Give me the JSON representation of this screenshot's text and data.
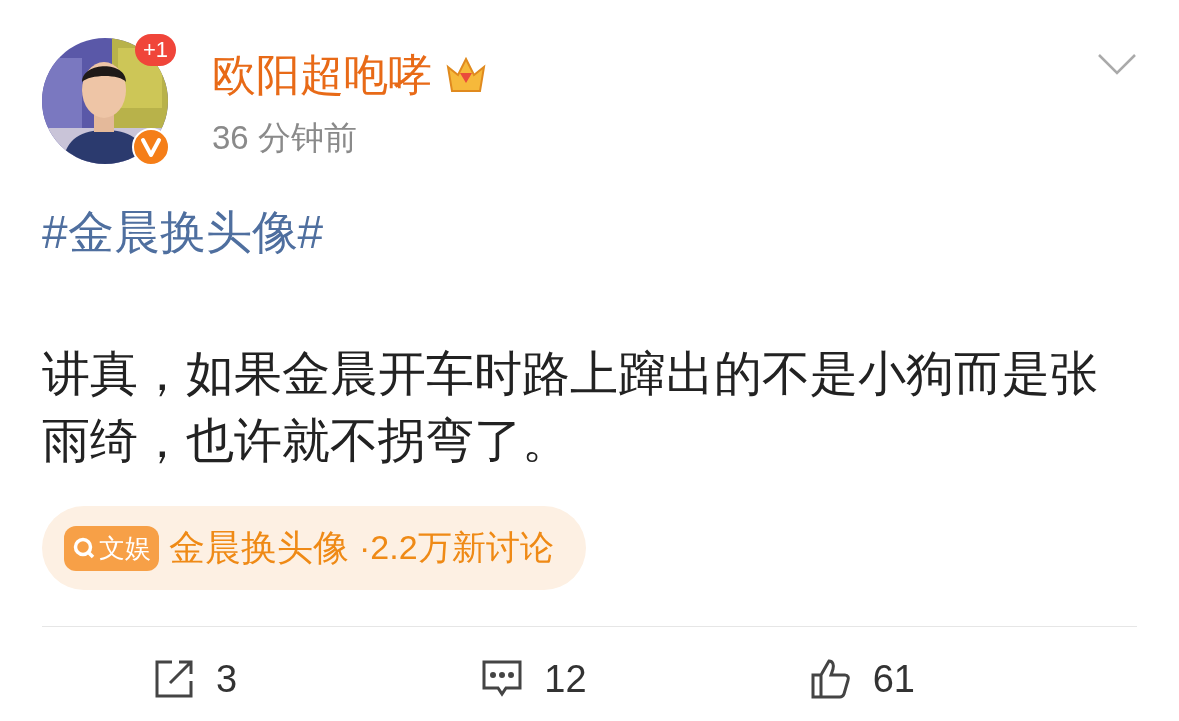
{
  "post": {
    "author": {
      "name": "欧阳超咆哮",
      "time": "36 分钟前",
      "notice_badge": "+1",
      "verified": true
    },
    "hashtag": "#金晨换头像#",
    "text": "讲真，如果金晨开车时路上蹿出的不是小狗而是张雨绮，也许就不拐弯了。",
    "topic": {
      "tag": "文娱",
      "name": "金晨换头像",
      "stats": "·2.2万新讨论"
    },
    "actions": [
      {
        "kind": "repost",
        "count": "3"
      },
      {
        "kind": "comment",
        "count": "12"
      },
      {
        "kind": "like",
        "count": "61"
      }
    ]
  }
}
